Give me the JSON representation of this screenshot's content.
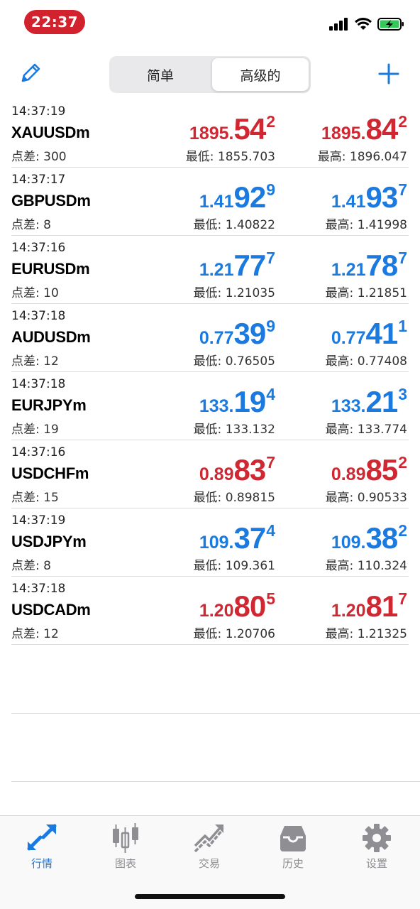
{
  "status_bar": {
    "time": "22:37"
  },
  "segmented": {
    "simple": "简单",
    "advanced": "高级的",
    "selected": "高级的"
  },
  "colors": {
    "up": "#1b7ae0",
    "down": "#d02833",
    "accent": "#1b7ae0"
  },
  "quotes": [
    {
      "time": "14:37:19",
      "symbol": "XAUUSDm",
      "spread": "点差: 300",
      "dir": "down",
      "bid": {
        "small": "1895.",
        "big": "54",
        "sup": "2"
      },
      "ask": {
        "small": "1895.",
        "big": "84",
        "sup": "2"
      },
      "low": "最低: 1855.703",
      "high": "最高: 1896.047"
    },
    {
      "time": "14:37:17",
      "symbol": "GBPUSDm",
      "spread": "点差: 8",
      "dir": "up",
      "bid": {
        "small": "1.41",
        "big": "92",
        "sup": "9"
      },
      "ask": {
        "small": "1.41",
        "big": "93",
        "sup": "7"
      },
      "low": "最低: 1.40822",
      "high": "最高: 1.41998"
    },
    {
      "time": "14:37:16",
      "symbol": "EURUSDm",
      "spread": "点差: 10",
      "dir": "up",
      "bid": {
        "small": "1.21",
        "big": "77",
        "sup": "7"
      },
      "ask": {
        "small": "1.21",
        "big": "78",
        "sup": "7"
      },
      "low": "最低: 1.21035",
      "high": "最高: 1.21851"
    },
    {
      "time": "14:37:18",
      "symbol": "AUDUSDm",
      "spread": "点差: 12",
      "dir": "up",
      "bid": {
        "small": "0.77",
        "big": "39",
        "sup": "9"
      },
      "ask": {
        "small": "0.77",
        "big": "41",
        "sup": "1"
      },
      "low": "最低: 0.76505",
      "high": "最高: 0.77408"
    },
    {
      "time": "14:37:18",
      "symbol": "EURJPYm",
      "spread": "点差: 19",
      "dir": "up",
      "bid": {
        "small": "133.",
        "big": "19",
        "sup": "4"
      },
      "ask": {
        "small": "133.",
        "big": "21",
        "sup": "3"
      },
      "low": "最低: 133.132",
      "high": "最高: 133.774"
    },
    {
      "time": "14:37:16",
      "symbol": "USDCHFm",
      "spread": "点差: 15",
      "dir": "down",
      "bid": {
        "small": "0.89",
        "big": "83",
        "sup": "7"
      },
      "ask": {
        "small": "0.89",
        "big": "85",
        "sup": "2"
      },
      "low": "最低: 0.89815",
      "high": "最高: 0.90533"
    },
    {
      "time": "14:37:19",
      "symbol": "USDJPYm",
      "spread": "点差: 8",
      "dir": "up",
      "bid": {
        "small": "109.",
        "big": "37",
        "sup": "4"
      },
      "ask": {
        "small": "109.",
        "big": "38",
        "sup": "2"
      },
      "low": "最低: 109.361",
      "high": "最高: 110.324"
    },
    {
      "time": "14:37:18",
      "symbol": "USDCADm",
      "spread": "点差: 12",
      "dir": "down",
      "bid": {
        "small": "1.20",
        "big": "80",
        "sup": "5"
      },
      "ask": {
        "small": "1.20",
        "big": "81",
        "sup": "7"
      },
      "low": "最低: 1.20706",
      "high": "最高: 1.21325"
    }
  ],
  "tabs": [
    {
      "label": "行情",
      "icon": "quotes-arrows-icon",
      "active": true
    },
    {
      "label": "图表",
      "icon": "candlestick-chart-icon",
      "active": false
    },
    {
      "label": "交易",
      "icon": "trade-trend-icon",
      "active": false
    },
    {
      "label": "历史",
      "icon": "history-inbox-icon",
      "active": false
    },
    {
      "label": "设置",
      "icon": "gear-icon",
      "active": false
    }
  ]
}
